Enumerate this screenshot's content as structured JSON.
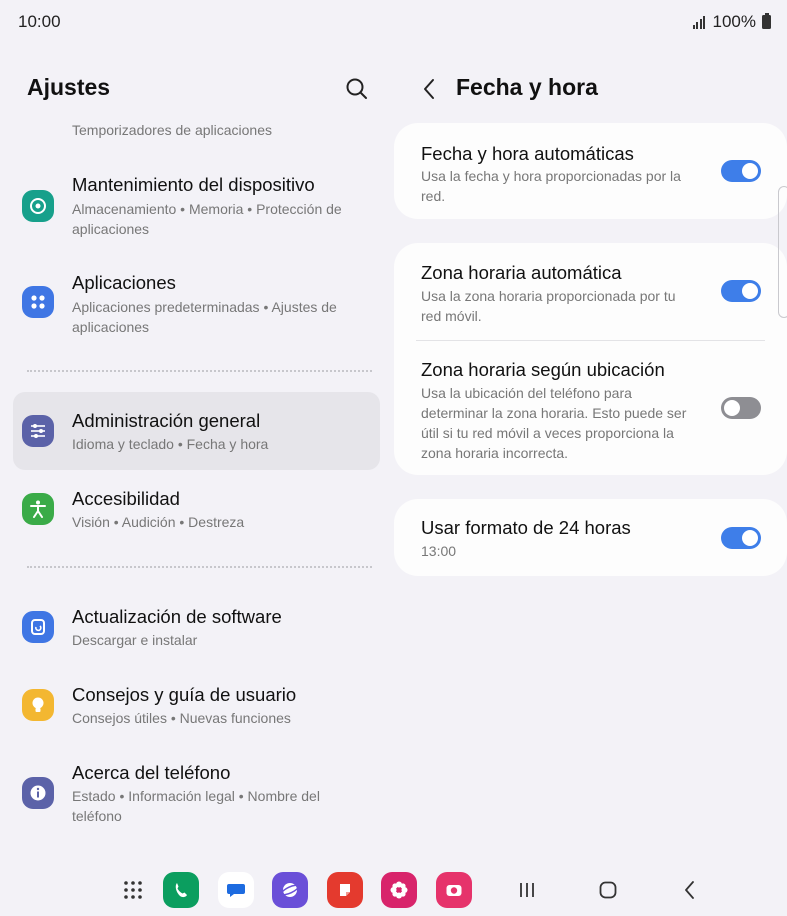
{
  "status": {
    "time": "10:00",
    "battery": "100%"
  },
  "left": {
    "title": "Ajustes",
    "section_sub": "Temporizadores de aplicaciones",
    "items": [
      {
        "title": "Mantenimiento del dispositivo",
        "sub": "Almacenamiento  •  Memoria  •  Protección de aplicaciones",
        "icon": "device-care-icon",
        "color": "#17a08b"
      },
      {
        "title": "Aplicaciones",
        "sub": "Aplicaciones predeterminadas  •  Ajustes de aplicaciones",
        "icon": "apps-icon",
        "color": "#3f76e4"
      },
      {
        "title": "Administración general",
        "sub": "Idioma y teclado  •  Fecha y hora",
        "icon": "sliders-icon",
        "color": "#5b62a8"
      },
      {
        "title": "Accesibilidad",
        "sub": "Visión  •  Audición  •  Destreza",
        "icon": "accessibility-icon",
        "color": "#3aab48"
      },
      {
        "title": "Actualización de software",
        "sub": "Descargar e instalar",
        "icon": "software-update-icon",
        "color": "#3f76e4"
      },
      {
        "title": "Consejos y guía de usuario",
        "sub": "Consejos útiles  •  Nuevas funciones",
        "icon": "lightbulb-icon",
        "color": "#f3b731"
      },
      {
        "title": "Acerca del teléfono",
        "sub": "Estado  •  Información legal  •  Nombre del teléfono",
        "icon": "info-icon",
        "color": "#5b62a8"
      }
    ]
  },
  "right": {
    "title": "Fecha y hora",
    "rows": [
      {
        "title": "Fecha y hora automáticas",
        "sub": "Usa la fecha y hora proporcionadas por la red.",
        "on": true
      },
      {
        "title": "Zona horaria automática",
        "sub": "Usa la zona horaria proporcionada por tu red móvil.",
        "on": true
      },
      {
        "title": "Zona horaria según ubicación",
        "sub": "Usa la ubicación del teléfono para determinar la zona horaria. Esto puede ser útil si tu red móvil a veces proporciona la zona horaria incorrecta.",
        "on": false
      },
      {
        "title": "Usar formato de 24 horas",
        "sub": "13:00",
        "on": true
      }
    ]
  },
  "navbar": {
    "apps": [
      {
        "icon": "app-drawer-icon"
      },
      {
        "icon": "phone-app-icon",
        "color": "#0b9e5f"
      },
      {
        "icon": "messages-app-icon",
        "color": "#1d6be0"
      },
      {
        "icon": "internet-app-icon",
        "color": "#6a4fd8"
      },
      {
        "icon": "notes-app-icon",
        "color": "#e43a2e"
      },
      {
        "icon": "gallery-app-icon",
        "color": "#d8246b"
      },
      {
        "icon": "camera-app-icon",
        "color": "#e6336b"
      }
    ],
    "buttons": [
      "recents-icon",
      "home-icon",
      "back-icon"
    ]
  }
}
